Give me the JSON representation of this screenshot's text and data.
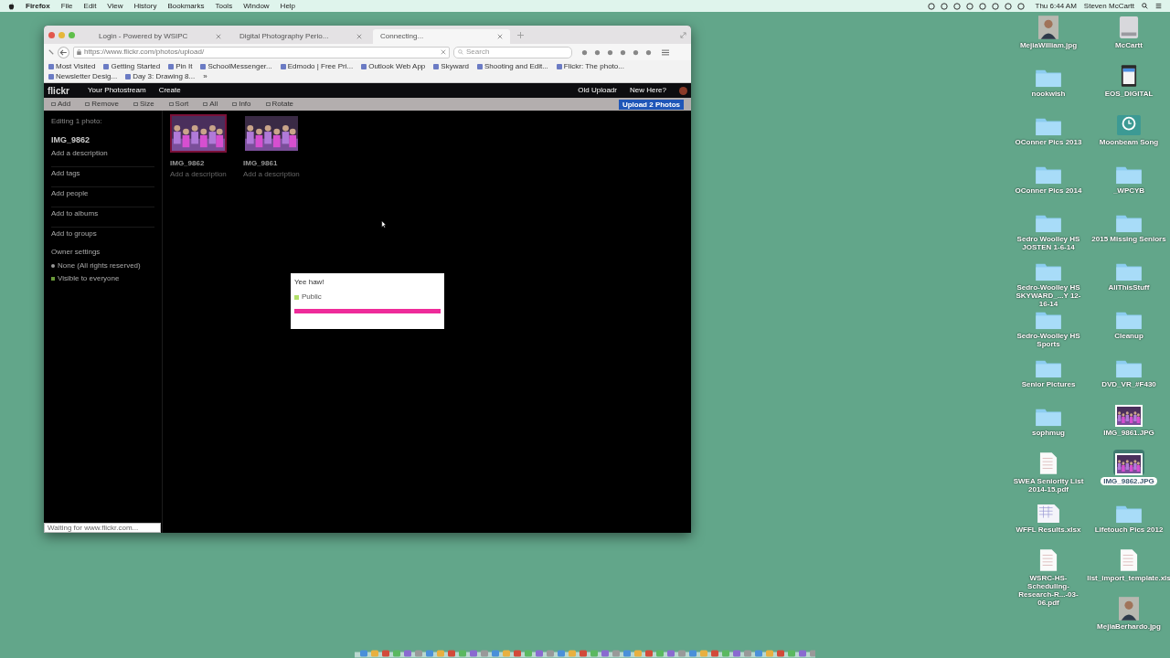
{
  "menu_bar": {
    "app": "Firefox",
    "items": [
      "File",
      "Edit",
      "View",
      "History",
      "Bookmarks",
      "Tools",
      "Window",
      "Help"
    ],
    "clock": "Thu 6:44 AM",
    "user": "Steven McCartt"
  },
  "browser": {
    "tabs": [
      {
        "label": "Login - Powered by WSIPC",
        "selected": false
      },
      {
        "label": "Digital Photography Perio...",
        "selected": false
      },
      {
        "label": "Connecting...",
        "selected": true
      }
    ],
    "url": "https://www.flickr.com/photos/upload/",
    "search": {
      "placeholder": "Search"
    },
    "bookmarks": [
      "Most Visited",
      "Getting Started",
      "Pin It",
      "SchoolMessenger...",
      "Edmodo | Free Pri...",
      "Outlook Web App",
      "Skyward",
      "Shooting and Edit...",
      "Flickr: The photo...",
      "Newsletter Desig...",
      "Day 3: Drawing 8...",
      "»"
    ],
    "status": "Waiting for www.flickr.com..."
  },
  "flickr": {
    "logo": "flickr",
    "nav": [
      "Your Photostream",
      "Create"
    ],
    "nav_right": [
      "Old Uploadr",
      "New Here?"
    ],
    "toolbar": [
      "Add",
      "Remove",
      "Size",
      "Sort",
      "All",
      "Info",
      "Rotate"
    ],
    "upload_button": "Upload 2 Photos",
    "sidebar": {
      "heading": "Editing 1 photo:",
      "photo_name": "IMG_9862",
      "description": "Add a description",
      "links": [
        "Add tags",
        "Add people",
        "Add to albums",
        "Add to groups"
      ],
      "owner_settings": "Owner settings",
      "license": "None (All rights reserved)",
      "visibility": "Visible to everyone"
    },
    "photos": [
      {
        "name": "IMG_9862",
        "description": "Add a description",
        "selected": true
      },
      {
        "name": "IMG_9861",
        "description": "Add a description",
        "selected": false
      }
    ],
    "dialog": {
      "title": "Yee haw!",
      "privacy": "Public",
      "level": 1
    }
  },
  "desktop_icons": {
    "left": [
      {
        "label": "MejiaWilliam.jpg",
        "kind": "portrait",
        "selected": false
      },
      {
        "label": "nookwish",
        "kind": "folder",
        "selected": false
      },
      {
        "label": "OConner Pics 2013",
        "kind": "folder",
        "selected": false
      },
      {
        "label": "OConner Pics 2014",
        "kind": "folder",
        "selected": false
      },
      {
        "label": "Sedro Woolley HS JOSTEN 1-6-14",
        "kind": "folder",
        "selected": false
      },
      {
        "label": "Sedro-Woolley HS SKYWARD_...Y 12-16-14",
        "kind": "folder",
        "selected": false
      },
      {
        "label": "Sedro-Woolley HS Sports",
        "kind": "folder",
        "selected": false
      },
      {
        "label": "Senior Pictures",
        "kind": "folder",
        "selected": false
      },
      {
        "label": "sophmug",
        "kind": "folder",
        "selected": false
      },
      {
        "label": "SWEA Seniority List 2014-15.pdf",
        "kind": "document",
        "selected": false
      },
      {
        "label": "WFFL Results.xlsx",
        "kind": "spreadsheet",
        "selected": false
      },
      {
        "label": "WSRC-HS-Scheduling-Research-R...-03-06.pdf",
        "kind": "document",
        "selected": false
      }
    ],
    "right": [
      {
        "label": "McCartt",
        "kind": "drive",
        "selected": false
      },
      {
        "label": "EOS_DIGITAL",
        "kind": "card",
        "selected": false
      },
      {
        "label": "Moonbeam Song",
        "kind": "backup",
        "selected": false
      },
      {
        "label": "_WPCYB",
        "kind": "folder",
        "selected": false
      },
      {
        "label": "2015 Missing Seniors",
        "kind": "folder",
        "selected": false
      },
      {
        "label": "AllThisStuff",
        "kind": "folder",
        "selected": false
      },
      {
        "label": "Cleanup",
        "kind": "folder",
        "selected": false
      },
      {
        "label": "DVD_VR_#F430",
        "kind": "folder",
        "selected": false
      },
      {
        "label": "IMG_9861.JPG",
        "selected": false
      },
      {
        "label": "IMG_9862.JPG",
        "selected": true
      },
      {
        "label": "Lifetouch Pics 2012",
        "kind": "folder",
        "selected": false
      },
      {
        "label": "list_import_template.xls",
        "kind": "document",
        "selected": false
      },
      {
        "label": "MejiaBerhardo.jpg",
        "kind": "portrait",
        "selected": false
      }
    ]
  }
}
